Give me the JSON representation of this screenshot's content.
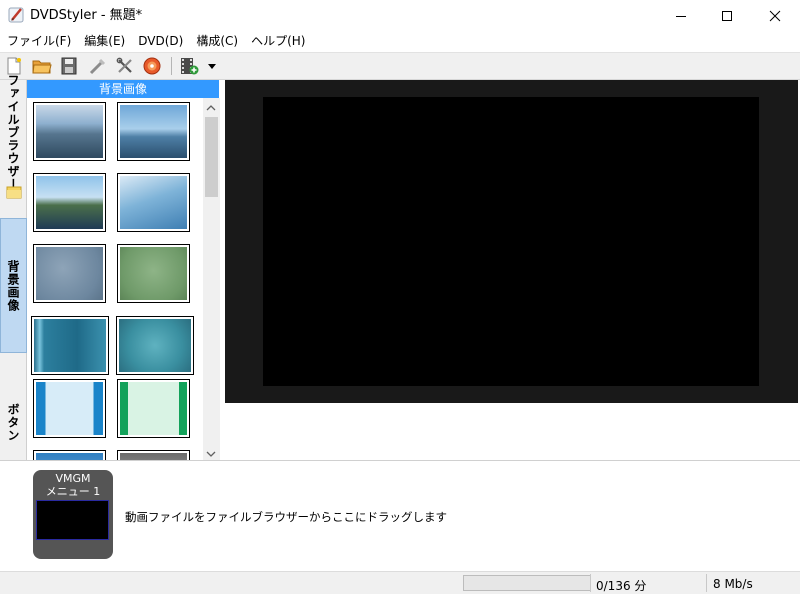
{
  "window": {
    "title": "DVDStyler - 無題*",
    "icon": "dvdstyler-brush-icon"
  },
  "menu": {
    "items": [
      {
        "label": "ファイル(F)"
      },
      {
        "label": "編集(E)"
      },
      {
        "label": "DVD(D)"
      },
      {
        "label": "構成(C)"
      },
      {
        "label": "ヘルプ(H)"
      }
    ]
  },
  "toolbar": {
    "buttons": [
      "new-file-icon",
      "open-folder-icon",
      "save-icon",
      "burn-wand-icon",
      "settings-tools-icon",
      "burn-disc-icon",
      "add-video-icon",
      "dropdown-arrow-icon"
    ]
  },
  "side_tabs": {
    "file_browser": "ファイルブラウザー",
    "backgrounds": "背景画像",
    "buttons": "ボタン"
  },
  "panel": {
    "header": "背景画像",
    "thumbnails": [
      {
        "name": "sea-coast-photo"
      },
      {
        "name": "harbor-boats-photo"
      },
      {
        "name": "lake-island-photo"
      },
      {
        "name": "blue-haze-photo"
      },
      {
        "name": "blue-gray-texture"
      },
      {
        "name": "green-texture"
      },
      {
        "name": "teal-gradient-stripes"
      },
      {
        "name": "teal-noise-texture"
      },
      {
        "name": "light-blue-frame"
      },
      {
        "name": "mint-green-frame"
      },
      {
        "name": "blue-gradient"
      },
      {
        "name": "gray-gradient"
      }
    ]
  },
  "titleset": {
    "vmgm_label": "VMGM",
    "menu_label": "メニュー 1",
    "hint": "動画ファイルをファイルブラウザーからここにドラッグします"
  },
  "status": {
    "progress_fraction": 0,
    "size": "0/136 分",
    "rate": "8 Mb/s"
  },
  "colors": {
    "accent": "#3399ff",
    "preview_bg": "#191919",
    "tab_selected": "#bfd9f2"
  }
}
